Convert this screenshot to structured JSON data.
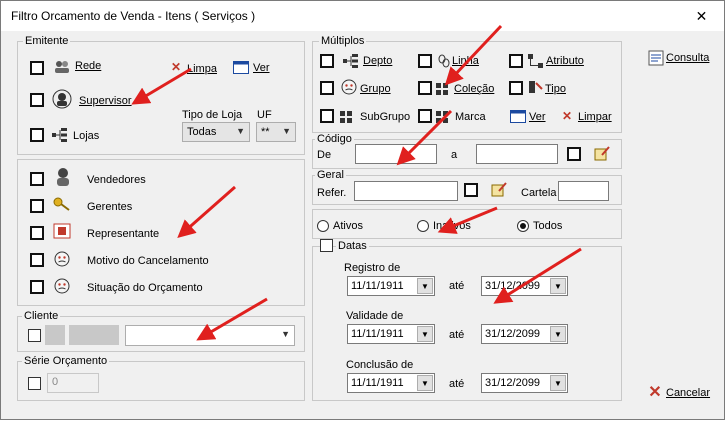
{
  "window": {
    "title": "Filtro Orcamento de Venda - Itens ( Serviços )",
    "close": "✕"
  },
  "emitente": {
    "legend": "Emitente",
    "rede": "Rede",
    "limpa": "Limpa",
    "ver": "Ver",
    "supervisor": "Supervisor",
    "lojas": "Lojas",
    "tipo_loja_label": "Tipo de Loja",
    "tipo_loja_value": "Todas",
    "uf_label": "UF",
    "uf_value": "**"
  },
  "lista": {
    "vendedores": "Vendedores",
    "gerentes": "Gerentes",
    "representante": "Representante",
    "motivo": "Motivo do Cancelamento",
    "situacao": "Situação do Orçamento"
  },
  "cliente": {
    "legend": "Cliente"
  },
  "serie": {
    "legend": "Série Orçamento",
    "value": "0"
  },
  "multiplos": {
    "legend": "Múltiplos",
    "depto": "Depto",
    "linha": "Linha",
    "atributo": "Atributo",
    "grupo": "Grupo",
    "colecao": "Coleção",
    "tipo": "Tipo",
    "subgrupo": "SubGrupo",
    "marca": "Marca",
    "ver": "Ver",
    "limpar": "Limpar"
  },
  "codigo": {
    "legend": "Código",
    "de": "De",
    "a": "a"
  },
  "geral": {
    "legend": "Geral",
    "refer": "Refer.",
    "cartela": "Cartela"
  },
  "status": {
    "ativos": "Ativos",
    "inativos": "Inativos",
    "todos": "Todos",
    "selected": "Todos"
  },
  "datas": {
    "legend": "Datas",
    "registro": "Registro de",
    "validade": "Validade de",
    "conclusao": "Conclusão de",
    "ate": "até",
    "reg_de": "11/11/1911",
    "reg_ate": "31/12/2099",
    "val_de": "11/11/1911",
    "val_ate": "31/12/2099",
    "con_de": "11/11/1911",
    "con_ate": "31/12/2099"
  },
  "actions": {
    "consulta": "Consulta",
    "cancelar": "Cancelar"
  },
  "colors": {
    "arrow": "#e0201e",
    "cancel": "#c0392b"
  }
}
